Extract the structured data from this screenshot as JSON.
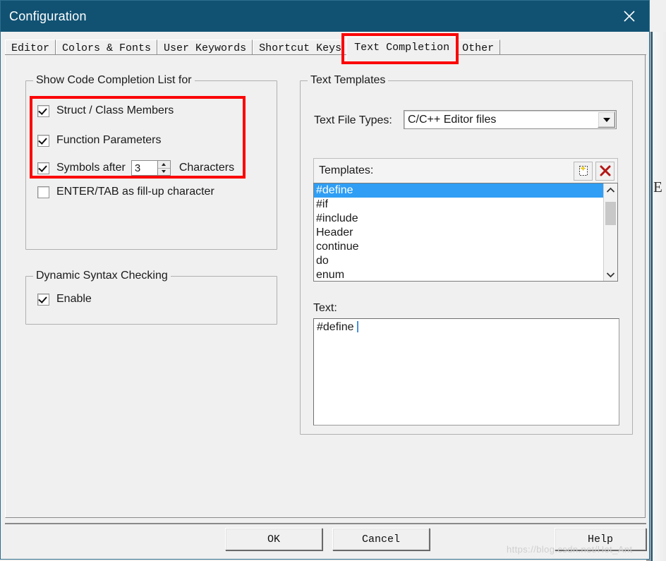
{
  "window": {
    "title": "Configuration",
    "close_icon": "close-icon",
    "titlebar_color": "#115273",
    "accent_selection": "#2f9ef4",
    "annotation_color": "#fb0505"
  },
  "tabs": [
    {
      "label": "Editor",
      "active": false
    },
    {
      "label": "Colors & Fonts",
      "active": false
    },
    {
      "label": "User Keywords",
      "active": false
    },
    {
      "label": "Shortcut Keys",
      "active": false
    },
    {
      "label": "Text Completion",
      "active": true
    },
    {
      "label": "Other",
      "active": false
    }
  ],
  "code_completion": {
    "group_title": "Show Code Completion List for",
    "options": [
      {
        "label": "Struct / Class Members",
        "checked": true
      },
      {
        "label": "Function Parameters",
        "checked": true
      },
      {
        "label": "Symbols after",
        "checked": true
      },
      {
        "label": "ENTER/TAB as fill-up character",
        "checked": false
      }
    ],
    "symbols_after_value": "3",
    "characters_label": "Characters",
    "spinner_up_icon": "spinner-up-icon",
    "spinner_down_icon": "spinner-down-icon"
  },
  "syntax_checking": {
    "group_title": "Dynamic Syntax Checking",
    "enable_label": "Enable",
    "enable_checked": true
  },
  "text_templates": {
    "group_title": "Text Templates",
    "file_types_label": "Text File Types:",
    "file_types_value": "C/C++ Editor files",
    "dropdown_icon": "chevron-down-icon",
    "templates_label": "Templates:",
    "new_template_icon": "new-template-icon",
    "delete_template_icon": "delete-x-icon",
    "items": [
      {
        "label": "#define",
        "selected": true
      },
      {
        "label": "#if",
        "selected": false
      },
      {
        "label": "#include",
        "selected": false
      },
      {
        "label": "Header",
        "selected": false
      },
      {
        "label": "continue",
        "selected": false
      },
      {
        "label": "do",
        "selected": false
      },
      {
        "label": "enum",
        "selected": false
      }
    ],
    "scroll_up_icon": "scroll-up-icon",
    "scroll_down_icon": "scroll-down-icon",
    "text_label": "Text:",
    "text_value": "#define "
  },
  "buttons": {
    "ok": "OK",
    "cancel": "Cancel",
    "help": "Help"
  },
  "watermark": "https://blog.csdn.net/Hot_Ant",
  "background": {
    "edge_letters": "E\nE"
  }
}
